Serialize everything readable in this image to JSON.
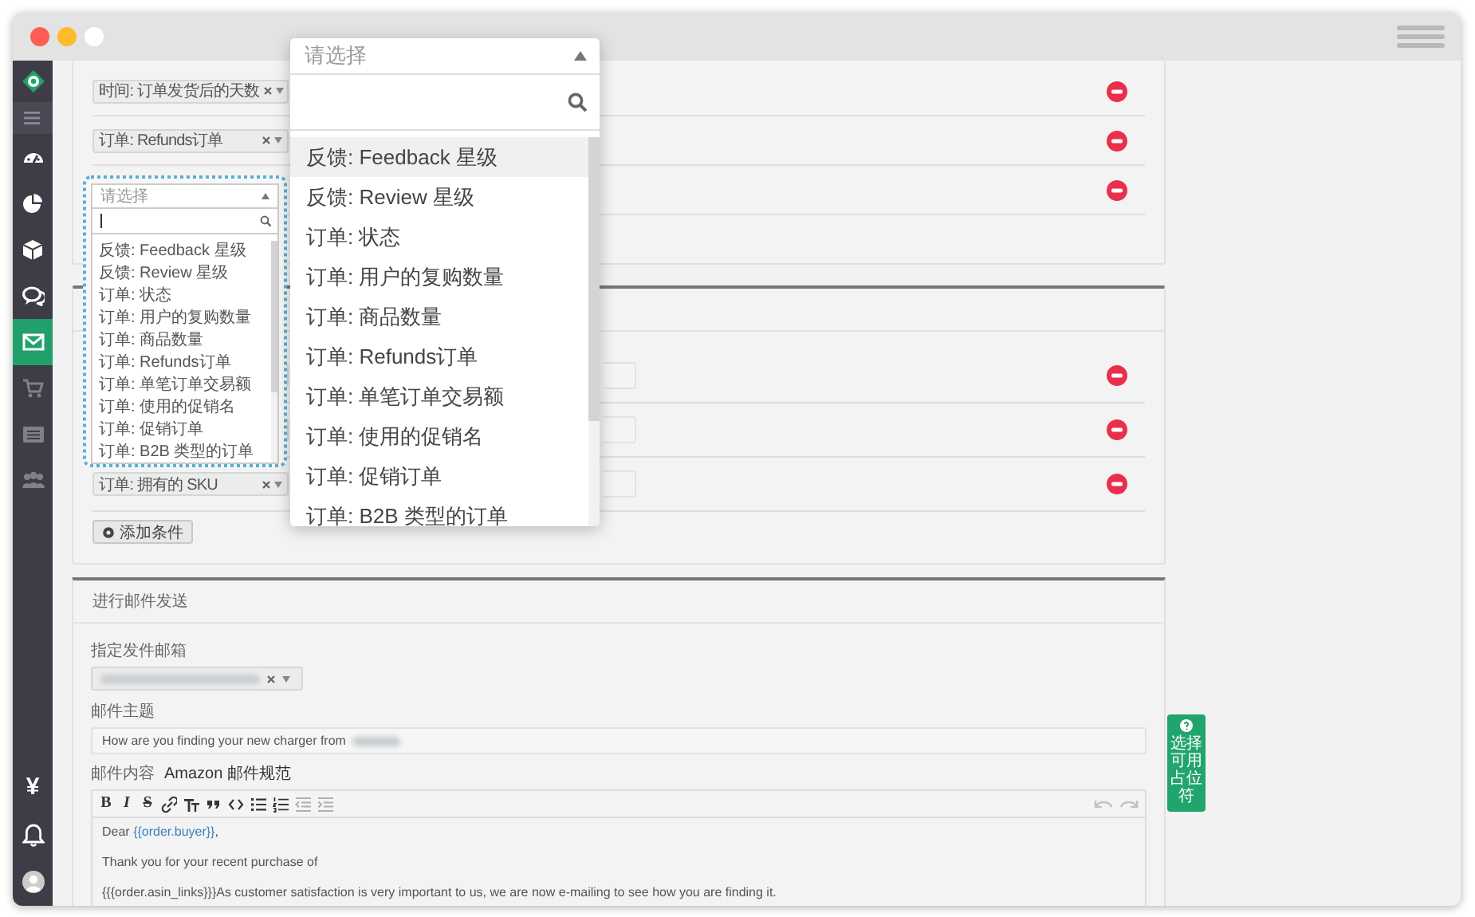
{
  "sidebar": {
    "items": [
      {
        "selected": false,
        "disabled": false
      },
      {
        "selected": false,
        "disabled": false
      },
      {
        "selected": false,
        "disabled": false
      },
      {
        "selected": false,
        "disabled": false
      },
      {
        "selected": false,
        "disabled": false
      },
      {
        "selected": true,
        "disabled": false
      },
      {
        "selected": false,
        "disabled": true
      },
      {
        "selected": false,
        "disabled": true
      },
      {
        "selected": false,
        "disabled": true
      }
    ],
    "currency_symbol": "¥"
  },
  "condition_panels": [
    {
      "rows": [
        {
          "kind": "select",
          "field": "时间: 订单发货后的天数"
        },
        {
          "kind": "select",
          "field": "订单: Refunds订单"
        },
        {
          "kind": "open"
        }
      ]
    },
    {
      "rows": [
        {
          "kind": "select",
          "value_field": true
        },
        {
          "kind": "select",
          "value_field": true
        },
        {
          "kind": "select",
          "field": "订单: 拥有的 SKU",
          "value_field": true
        }
      ],
      "add_button": "添加条件"
    }
  ],
  "open_dropdown": {
    "placeholder": "请选择",
    "items": [
      {
        "label": "反馈: Feedback 星级"
      },
      {
        "label": "反馈: Review 星级"
      },
      {
        "label": "订单: 状态"
      },
      {
        "label": "订单: 用户的复购数量"
      },
      {
        "label": "订单: 商品数量"
      },
      {
        "label": "订单: Refunds订单"
      },
      {
        "label": "订单: 单笔订单交易额"
      },
      {
        "label": "订单: 使用的促销名"
      },
      {
        "label": "订单: 促销订单"
      },
      {
        "label": "订单: B2B 类型的订单"
      }
    ]
  },
  "magnified_dropdown": {
    "placeholder": "请选择",
    "items": [
      {
        "label": "反馈: Feedback 星级",
        "selected": true
      },
      {
        "label": "反馈: Review 星级",
        "selected": false
      },
      {
        "label": "订单: 状态",
        "selected": false
      },
      {
        "label": "订单: 用户的复购数量",
        "selected": false
      },
      {
        "label": "订单: 商品数量",
        "selected": false
      },
      {
        "label": "订单: Refunds订单",
        "selected": false
      },
      {
        "label": "订单: 单笔订单交易额",
        "selected": false
      },
      {
        "label": "订单: 使用的促销名",
        "selected": false
      },
      {
        "label": "订单: 促销订单",
        "selected": false
      },
      {
        "label": "订单: B2B 类型的订单",
        "selected": false
      }
    ]
  },
  "mail_panel": {
    "title": "进行邮件发送",
    "sender_label": "指定发件邮箱",
    "subject_label": "邮件主题",
    "subject_value": "How are you finding your new charger from",
    "body_label": "邮件内容",
    "body_link": "Amazon 邮件规范",
    "toolbar": [
      {
        "kind": "bold",
        "label": "B",
        "disabled": false
      },
      {
        "kind": "italic",
        "label": "I",
        "disabled": false
      },
      {
        "kind": "strike",
        "label": "S",
        "disabled": false
      },
      {
        "kind": "link",
        "disabled": false
      },
      {
        "kind": "heading",
        "disabled": false
      },
      {
        "kind": "quote",
        "disabled": false
      },
      {
        "kind": "code",
        "disabled": false
      },
      {
        "kind": "bullets",
        "disabled": false
      },
      {
        "kind": "numbers",
        "disabled": false
      },
      {
        "kind": "outdent",
        "disabled": true
      },
      {
        "kind": "indent",
        "disabled": true
      }
    ],
    "history": [
      {
        "kind": "undo",
        "disabled": true
      },
      {
        "kind": "redo",
        "disabled": true
      }
    ],
    "body": [
      [
        {
          "text": "Dear "
        },
        {
          "text": "{{order.buyer}}",
          "kind": "token"
        },
        {
          "text": ","
        }
      ],
      [
        {
          "text": "Thank you for your recent purchase of"
        }
      ],
      [
        {
          "text": "{{{order.asin_links}}}As customer satisfaction is very important to us, we are now e-mailing to see how you are finding it."
        }
      ]
    ]
  },
  "placeholder_tab": {
    "label": "选择可用占位符"
  }
}
